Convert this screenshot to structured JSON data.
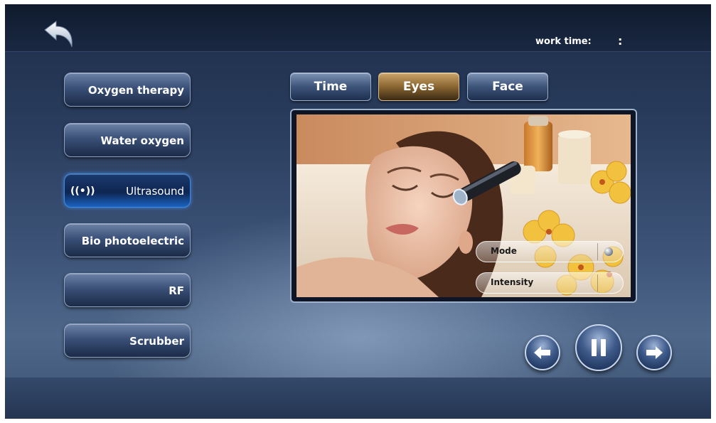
{
  "header": {
    "work_time_label": "work time:",
    "work_time_value": ":"
  },
  "sidebar": {
    "items": [
      {
        "label": "Oxygen therapy"
      },
      {
        "label": "Water oxygen"
      },
      {
        "label": "Ultrasound",
        "active": true,
        "icon": "((•))"
      },
      {
        "label": "Bio photoelectric"
      },
      {
        "label": "RF"
      },
      {
        "label": "Scrubber"
      }
    ]
  },
  "tabs": [
    {
      "label": "Time"
    },
    {
      "label": "Eyes",
      "active": true
    },
    {
      "label": "Face"
    }
  ],
  "controls": {
    "mode_label": "Mode",
    "intensity_label": "Intensity"
  },
  "icons": {
    "back": "back-arrow-icon",
    "prev": "left-arrow-icon",
    "pause": "pause-icon",
    "next": "right-arrow-icon"
  },
  "colors": {
    "active_tab": "#8a6530",
    "active_side": "#1a63c0",
    "background": "#2a3d5e"
  }
}
